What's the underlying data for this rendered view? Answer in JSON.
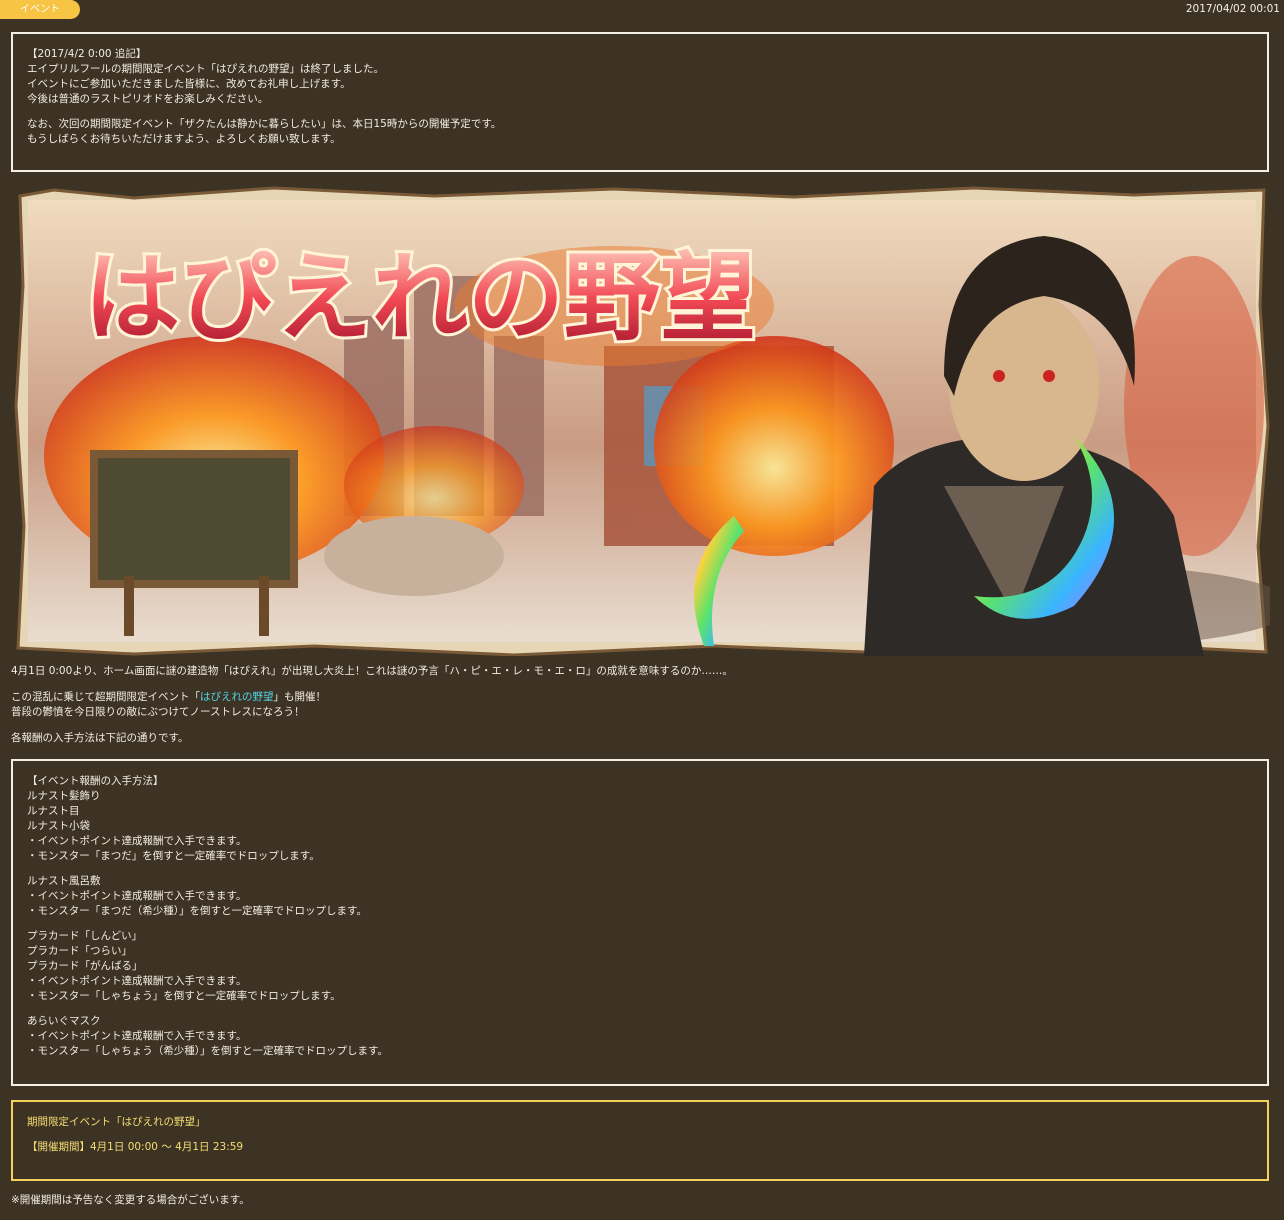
{
  "header": {
    "badge": "イベント",
    "date": "2017/04/02 00:01"
  },
  "notice": {
    "lines1": [
      "【2017/4/2 0:00 追記】",
      "エイプリルフールの期間限定イベント「はぴえれの野望」は終了しました。",
      "イベントにご参加いただきました皆様に、改めてお礼申し上げます。",
      "今後は普通のラストピリオドをお楽しみください。"
    ],
    "lines2": [
      "なお、次回の期間限定イベント「ザクたんは静かに暮らしたい」は、本日15時からの開催予定です。",
      "もうしばらくお待ちいただけますよう、よろしくお願い致します。"
    ]
  },
  "banner": {
    "title": "はぴえれの野望",
    "colors": {
      "fire": "#ff7a1a",
      "sky": "#e8c7a0",
      "title_fill": "#e8394a",
      "frame": "#d9c8a8"
    }
  },
  "intro": {
    "p1": "4月1日 0:00より、ホーム画面に謎の建造物「はぴえれ」が出現し大炎上！これは謎の予言「ハ・ピ・エ・レ・モ・エ・ロ」の成就を意味するのか……。",
    "p2_prefix": "この混乱に乗じて超期間限定イベント「",
    "p2_link": "はぴえれの野望",
    "p2_suffix": "」も開催！",
    "p2_line2": "普段の鬱憤を今日限りの敵にぶつけてノーストレスになろう！",
    "p3": "各報酬の入手方法は下記の通りです。"
  },
  "rewards": {
    "groups": [
      [
        "【イベント報酬の入手方法】",
        "ルナスト髪飾り",
        "ルナスト目",
        "ルナスト小袋",
        "・イベントポイント達成報酬で入手できます。",
        "・モンスター「まつだ」を倒すと一定確率でドロップします。"
      ],
      [
        "ルナスト風呂敷",
        "・イベントポイント達成報酬で入手できます。",
        "・モンスター「まつだ（希少種）」を倒すと一定確率でドロップします。"
      ],
      [
        "プラカード「しんどい」",
        "プラカード「つらい」",
        "プラカード「がんばる」",
        "・イベントポイント達成報酬で入手できます。",
        "・モンスター「しゃちょう」を倒すと一定確率でドロップします。"
      ],
      [
        "あらいぐマスク",
        "・イベントポイント達成報酬で入手できます。",
        "・モンスター「しゃちょう（希少種）」を倒すと一定確率でドロップします。"
      ]
    ]
  },
  "period": {
    "title": "期間限定イベント「はぴえれの野望」",
    "dates": "【開催期間】4月1日 00:00 ～ 4月1日 23:59"
  },
  "footer": {
    "note": "※開催期間は予告なく変更する場合がございます。"
  }
}
